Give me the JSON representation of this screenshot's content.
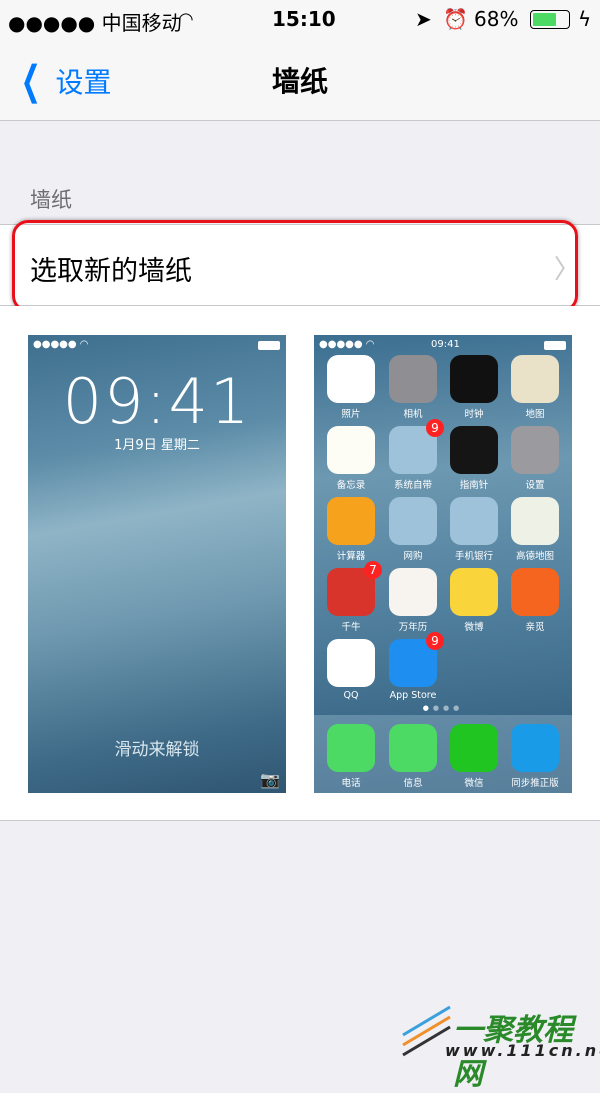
{
  "status_bar": {
    "carrier": "●●●●● 中国移动",
    "time": "15:10",
    "battery": "68%"
  },
  "nav": {
    "back_label": "设置",
    "title": "墙纸"
  },
  "section_header": "墙纸",
  "choose_row": {
    "label": "选取新的墙纸"
  },
  "lock_preview": {
    "time": "09:41",
    "date": "1月9日 星期二",
    "slide_text": "滑动来解锁"
  },
  "home_preview": {
    "time": "09:41",
    "apps": [
      {
        "name": "照片",
        "color": "#ffffff",
        "badge": ""
      },
      {
        "name": "相机",
        "color": "#8e8e93",
        "badge": ""
      },
      {
        "name": "时钟",
        "color": "#111111",
        "badge": ""
      },
      {
        "name": "地图",
        "color": "#e9e1c8",
        "badge": ""
      },
      {
        "name": "备忘录",
        "color": "#fdfcf5",
        "badge": ""
      },
      {
        "name": "系统自带",
        "color": "#9ec2da",
        "badge": "9"
      },
      {
        "name": "指南针",
        "color": "#151515",
        "badge": ""
      },
      {
        "name": "设置",
        "color": "#9a9a9f",
        "badge": ""
      },
      {
        "name": "计算器",
        "color": "#f6a21d",
        "badge": ""
      },
      {
        "name": "网购",
        "color": "#9ec2da",
        "badge": ""
      },
      {
        "name": "手机银行",
        "color": "#9ec2da",
        "badge": ""
      },
      {
        "name": "高德地图",
        "color": "#eef2e6",
        "badge": ""
      },
      {
        "name": "千牛",
        "color": "#d9342b",
        "badge": "7"
      },
      {
        "name": "万年历",
        "color": "#f7f3ee",
        "badge": ""
      },
      {
        "name": "微博",
        "color": "#f9d43a",
        "badge": ""
      },
      {
        "name": "亲觅",
        "color": "#f5651f",
        "badge": ""
      },
      {
        "name": "QQ",
        "color": "#ffffff",
        "badge": ""
      },
      {
        "name": "App Store",
        "color": "#1e8ff0",
        "badge": "9"
      }
    ],
    "dock": [
      {
        "name": "电话",
        "color": "#4cd964"
      },
      {
        "name": "信息",
        "color": "#4cd964"
      },
      {
        "name": "微信",
        "color": "#21c521"
      },
      {
        "name": "同步推正版",
        "color": "#1a9be8"
      }
    ]
  },
  "watermark": {
    "title": "一聚教程网",
    "url": "www.111cn.net"
  }
}
